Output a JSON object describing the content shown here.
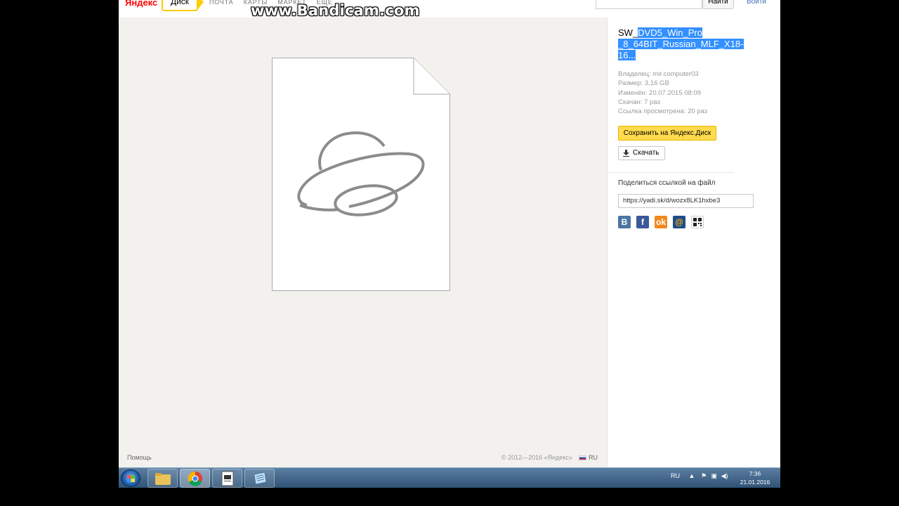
{
  "watermark": "www.Bandicam.com",
  "header": {
    "logo_yandex": "Яндекс",
    "logo_disk": "Диск",
    "nav": [
      "ПОЧТА",
      "КАРТЫ",
      "МАРКЕТ",
      "ЕЩЁ"
    ],
    "search_button": "Найти",
    "login": "Войти"
  },
  "file": {
    "name_prefix": "SW_",
    "name_selected": "DVD5_Win_Pro _8_64BIT_Russian_MLF_X18- 16...",
    "owner": "Владелец: mir.computer03",
    "size": "Размер: 3,16 GB",
    "modified": "Изменён: 20.07.2015 08:09",
    "downloaded": "Скачан: 7 раз",
    "views": "Ссылка просмотрена: 20 раз",
    "save_button": "Сохранить на Яндекс.Диск",
    "download_button": "Скачать"
  },
  "share": {
    "title": "Поделиться ссылкой на файл",
    "link": "https://yadi.sk/d/wozx8LK1hxbe3",
    "icons": [
      "vk-icon",
      "facebook-icon",
      "odnoklassniki-icon",
      "mailru-icon",
      "qr-code-icon"
    ]
  },
  "footer": {
    "help": "Помощь",
    "copyright": "© 2012—2016 «Яндекс»",
    "lang": "RU"
  },
  "taskbar": {
    "lang": "RU",
    "time": "7:36",
    "date": "21.01.2016"
  },
  "colors": {
    "accent_yellow": "#ffdb4d",
    "selection": "#3390ff",
    "link": "#3a72b5",
    "preview_bg": "#f2f1ee"
  }
}
